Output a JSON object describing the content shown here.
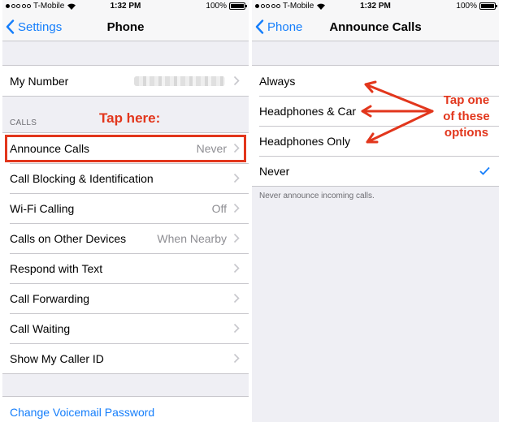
{
  "left": {
    "status": {
      "carrier": "T-Mobile",
      "time": "1:32 PM",
      "battery": "100%"
    },
    "nav": {
      "back_label": "Settings",
      "title": "Phone"
    },
    "my_number": {
      "label": "My Number"
    },
    "calls_header": "CALLS",
    "calls": [
      {
        "label": "Announce Calls",
        "value": "Never"
      },
      {
        "label": "Call Blocking & Identification",
        "value": ""
      },
      {
        "label": "Wi-Fi Calling",
        "value": "Off"
      },
      {
        "label": "Calls on Other Devices",
        "value": "When Nearby"
      },
      {
        "label": "Respond with Text",
        "value": ""
      },
      {
        "label": "Call Forwarding",
        "value": ""
      },
      {
        "label": "Call Waiting",
        "value": ""
      },
      {
        "label": "Show My Caller ID",
        "value": ""
      }
    ],
    "voicemail_link": "Change Voicemail Password"
  },
  "right": {
    "status": {
      "carrier": "T-Mobile",
      "time": "1:32 PM",
      "battery": "100%"
    },
    "nav": {
      "back_label": "Phone",
      "title": "Announce Calls"
    },
    "options": [
      {
        "label": "Always",
        "selected": false
      },
      {
        "label": "Headphones & Car",
        "selected": false
      },
      {
        "label": "Headphones Only",
        "selected": false
      },
      {
        "label": "Never",
        "selected": true
      }
    ],
    "footer": "Never announce incoming calls."
  },
  "annotations": {
    "tap_here": "Tap here:",
    "tap_options": [
      "Tap one",
      "of these",
      "options"
    ],
    "color": "#e2361c"
  },
  "colors": {
    "accent": "#157efb",
    "background": "#efeff4",
    "secondary_text": "#8e8e93"
  }
}
